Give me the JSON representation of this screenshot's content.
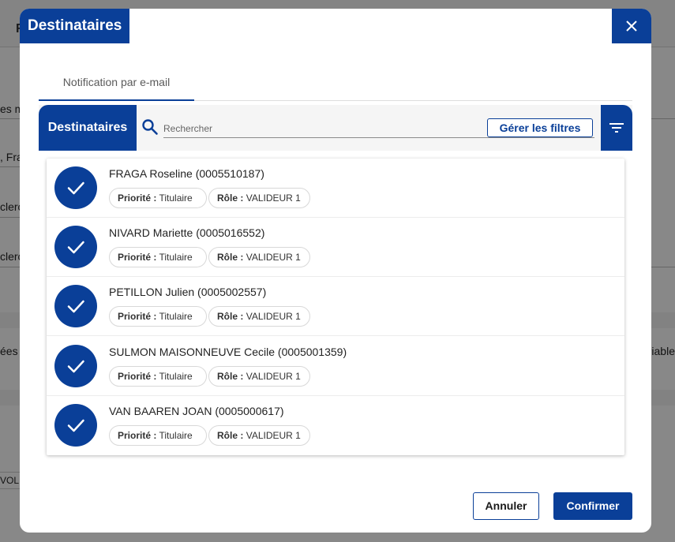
{
  "background": {
    "header_fragment": "R",
    "fragments_left": [
      "es m",
      ", Fra",
      "clerc",
      "clerc",
      "ées"
    ],
    "fragment_right": "riable",
    "vol_fragment": "VOL"
  },
  "modal": {
    "title": "Destinataires",
    "close_icon": "close-icon",
    "tabs": [
      {
        "label": "Notification par e-mail",
        "active": true
      }
    ],
    "toolbar": {
      "label": "Destinataires",
      "search_placeholder": "Rechercher",
      "filters_button": "Gérer les filtres",
      "filter_icon": "filter-icon"
    },
    "chip_labels": {
      "priority": "Priorité",
      "role": "Rôle",
      "separator": ":"
    },
    "recipients": [
      {
        "name": "FRAGA Roseline (0005510187)",
        "priority": "Titulaire",
        "role": "VALIDEUR 1",
        "checked": true
      },
      {
        "name": "NIVARD Mariette (0005016552)",
        "priority": "Titulaire",
        "role": "VALIDEUR 1",
        "checked": true
      },
      {
        "name": "PETILLON Julien (0005002557)",
        "priority": "Titulaire",
        "role": "VALIDEUR 1",
        "checked": true
      },
      {
        "name": "SULMON MAISONNEUVE Cecile (0005001359)",
        "priority": "Titulaire",
        "role": "VALIDEUR 1",
        "checked": true
      },
      {
        "name": "VAN BAAREN JOAN (0005000617)",
        "priority": "Titulaire",
        "role": "VALIDEUR 1",
        "checked": true
      }
    ],
    "footer": {
      "cancel": "Annuler",
      "confirm": "Confirmer"
    }
  },
  "colors": {
    "primary": "#0a3f98",
    "overlay": "rgba(0,0,0,0.46)"
  }
}
